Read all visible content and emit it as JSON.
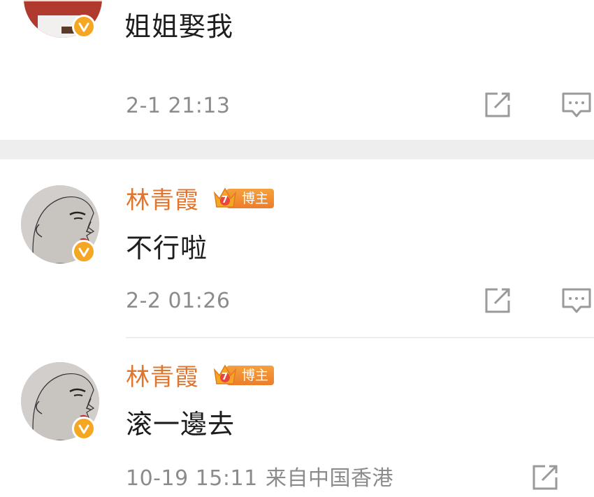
{
  "comments": [
    {
      "username": "",
      "text": "姐姐娶我",
      "time": "2-1 21:13",
      "verified": true
    },
    {
      "username": "林青霞",
      "badge_level": "7",
      "badge_label": "博主",
      "text": "不行啦",
      "time": "2-2 01:26",
      "verified": true
    },
    {
      "username": "林青霞",
      "badge_level": "7",
      "badge_label": "博主",
      "text": "滚一邊去",
      "time": "10-19 15:11",
      "location": "来自中国香港",
      "verified": true
    }
  ],
  "colors": {
    "username": "#e0752d",
    "verified_badge": "#f5a623",
    "timestamp": "#8b8b8b",
    "icon": "#9a9a9a"
  },
  "icons": [
    "share-icon",
    "comment-icon",
    "verified-icon",
    "crown-icon"
  ]
}
